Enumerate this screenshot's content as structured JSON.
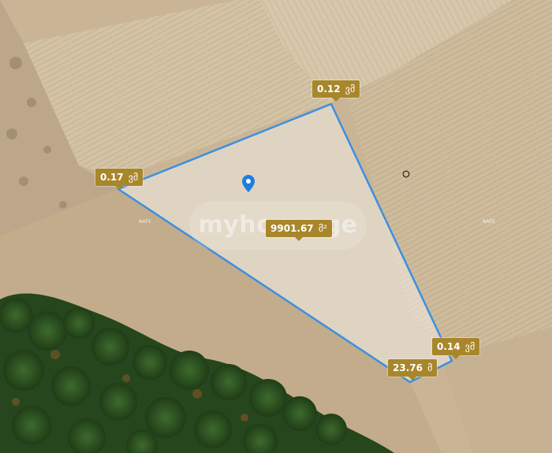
{
  "map": {
    "watermark": "myhome.ge",
    "tiny_labels": [
      "NAFE",
      "NAFE"
    ],
    "colors": {
      "boundary": "#3d8fe0",
      "label_bg": "#a8862a",
      "label_text": "#ffffff",
      "marker": "#1c7fe0"
    },
    "icons": {
      "location_pin": "map-pin-icon",
      "circle_marker": "circle-marker-icon"
    }
  },
  "measurements": {
    "area": {
      "value": "9901.67",
      "unit": "მ²"
    },
    "vertex_top": {
      "value": "0.12",
      "unit": "ვმ"
    },
    "vertex_left": {
      "value": "0.17",
      "unit": "ვმ"
    },
    "vertex_right": {
      "value": "0.14",
      "unit": "ვმ"
    },
    "side_bottom": {
      "value": "23.76",
      "unit": "მ"
    }
  }
}
